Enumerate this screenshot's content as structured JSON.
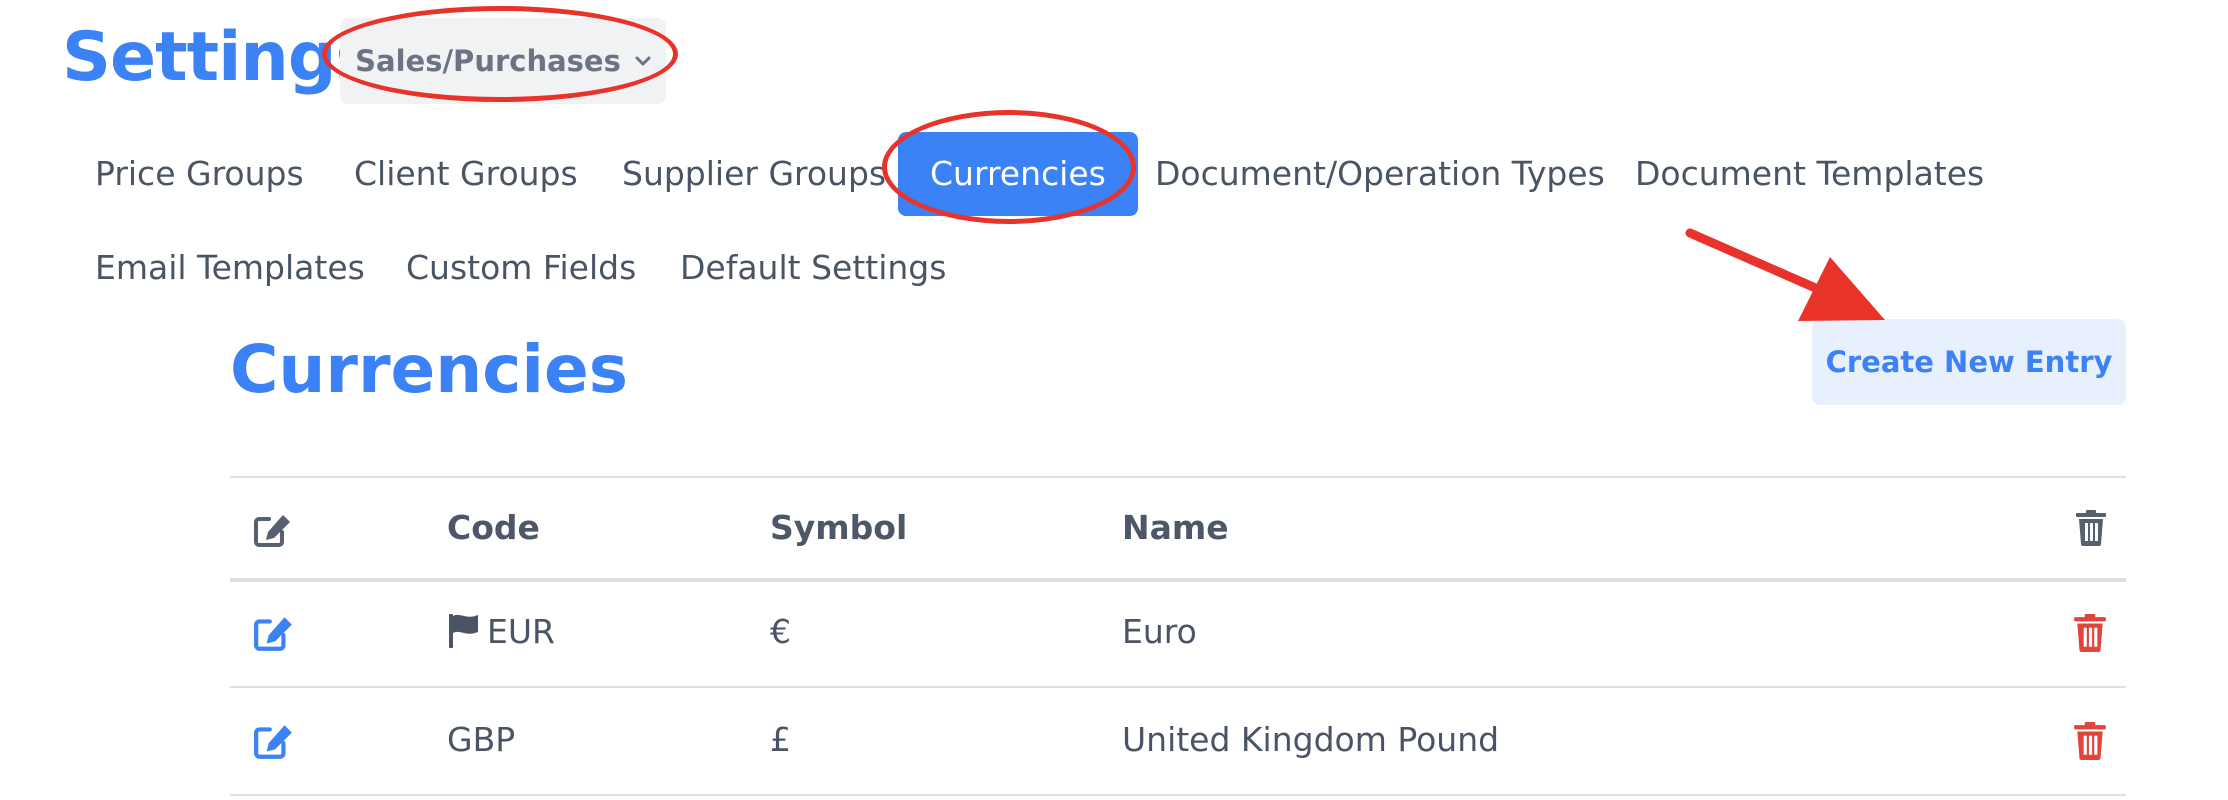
{
  "header": {
    "title": "Settings",
    "module_dropdown": {
      "selected": "Sales/Purchases",
      "icon": "chevron-down-icon"
    }
  },
  "tabs": [
    {
      "label": "Price Groups"
    },
    {
      "label": "Client Groups"
    },
    {
      "label": "Supplier Groups"
    },
    {
      "label": "Currencies",
      "active": true
    },
    {
      "label": "Document/Operation Types"
    },
    {
      "label": "Document Templates"
    },
    {
      "label": "Email Templates"
    },
    {
      "label": "Custom Fields"
    },
    {
      "label": "Default Settings"
    }
  ],
  "section": {
    "title": "Currencies",
    "create_button": "Create New Entry"
  },
  "table": {
    "columns": {
      "code": "Code",
      "symbol": "Symbol",
      "name": "Name"
    },
    "header_icons": {
      "edit": "edit-icon",
      "delete": "trash-icon"
    },
    "rows": [
      {
        "code": "EUR",
        "symbol": "€",
        "name": "Euro",
        "default_flag": true
      },
      {
        "code": "GBP",
        "symbol": "£",
        "name": "United Kingdom Pound",
        "default_flag": false
      }
    ]
  },
  "colors": {
    "accent": "#3b82f6",
    "danger": "#e0443a",
    "annotation": "#e8332a"
  }
}
